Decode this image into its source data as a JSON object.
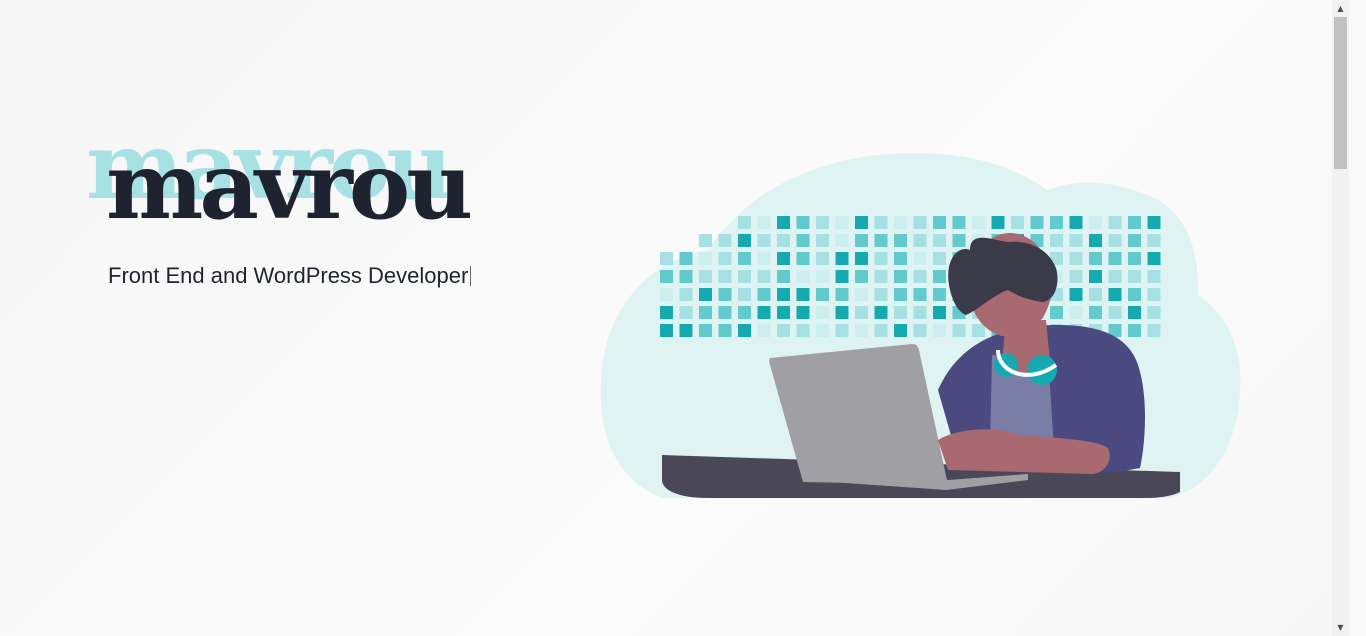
{
  "hero": {
    "logo_shadow": "mavrou",
    "logo_text": "mavrou",
    "tagline": "Front End and WordPress Developer"
  },
  "illustration": {
    "name": "developer-with-laptop",
    "colors": {
      "cloud": "#e0f3f3",
      "tile_dark": "#16a9b0",
      "tile_mid": "#62c9cc",
      "tile_light": "#a6e0e2",
      "tile_pale": "#cdeeee",
      "desk": "#4a4858",
      "laptop": "#a0a0a4",
      "jacket": "#4b4a80",
      "skin": "#a86a70",
      "hair": "#3b3a48",
      "headphones": "#16a9b0"
    }
  },
  "scrollbar": {
    "up_icon": "▲",
    "down_icon": "▼"
  }
}
